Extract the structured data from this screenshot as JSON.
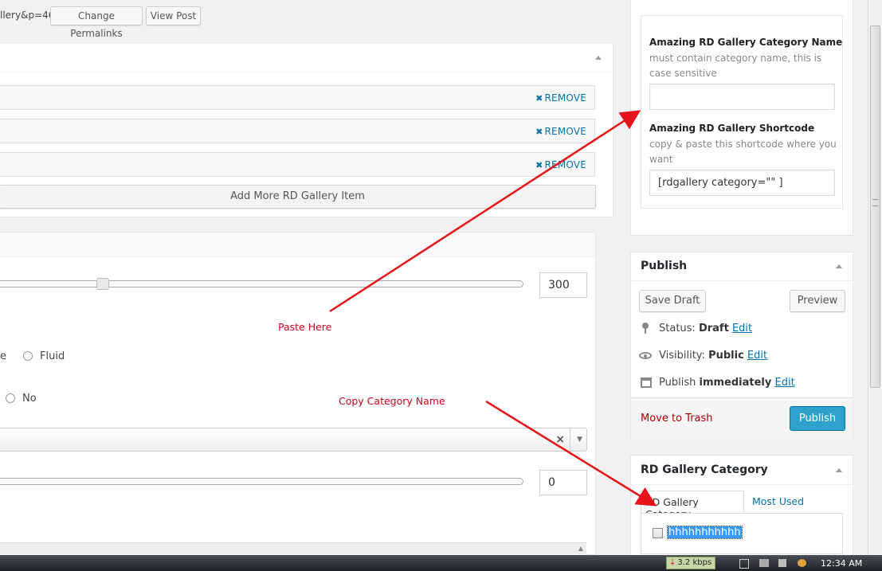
{
  "permalink": {
    "url_fragment": "llery&p=46",
    "change_button": "Change Permalinks",
    "view_button": "View Post"
  },
  "gallery_items": {
    "remove_label": "REMOVE",
    "add_more_button": "Add More RD Gallery Item"
  },
  "settings": {
    "slider1_value": "300",
    "radio_fragment": "e",
    "fluid_label": "Fluid",
    "no_label": "No",
    "select_clear": "×",
    "slider2_value": "0"
  },
  "category_meta": {
    "name_label": "Amazing RD Gallery Category Name",
    "name_desc": "must contain category name, this is case sensitive",
    "name_value": "",
    "shortcode_label": "Amazing RD Gallery Shortcode",
    "shortcode_desc": "copy & paste this shortcode where you want",
    "shortcode_value": "[rdgallery category=\"\" ]"
  },
  "publish": {
    "title": "Publish",
    "save_draft": "Save Draft",
    "preview": "Preview",
    "status_label": "Status:",
    "status_value": "Draft",
    "visibility_label": "Visibility:",
    "visibility_value": "Public",
    "publish_label": "Publish",
    "publish_when": "immediately",
    "edit_label": "Edit",
    "trash": "Move to Trash",
    "publish_button": "Publish"
  },
  "category_box": {
    "title": "RD Gallery Category",
    "tab_all": "RD Gallery Category",
    "tab_used": "Most Used",
    "item": "hhhhhhhhhhh"
  },
  "annotations": {
    "paste": "Paste Here",
    "copy": "Copy Category Name"
  },
  "taskbar": {
    "speed": "3.2 kbps",
    "clock": "12:34 AM"
  },
  "colors": {
    "accent": "#0073aa",
    "publish_button": "#2ea2cc",
    "annotation": "#d0021b",
    "trash": "#a00"
  }
}
